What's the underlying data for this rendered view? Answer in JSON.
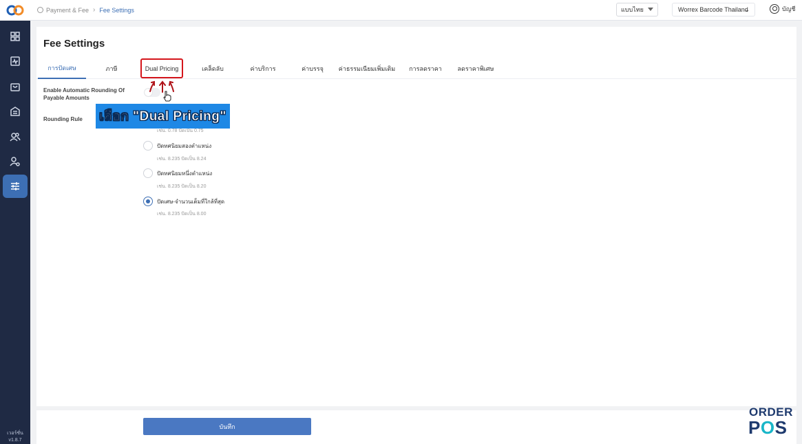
{
  "sidebar": {
    "logo": "order-pos-logo",
    "items": [
      {
        "icon": "dashboard-grid-icon"
      },
      {
        "icon": "activity-chart-icon"
      },
      {
        "icon": "shopping-bag-icon"
      },
      {
        "icon": "inventory-box-icon"
      },
      {
        "icon": "customers-group-icon"
      },
      {
        "icon": "user-settings-icon"
      },
      {
        "icon": "settings-sliders-icon",
        "active": true
      }
    ],
    "version_label": "เวอร์ชั่น",
    "version_number": "v1.8.7"
  },
  "topbar": {
    "breadcrumb_root": "Payment & Fee",
    "breadcrumb_current": "Fee Settings",
    "language": "แบบไทย",
    "store": "Worrex Barcode Thailand",
    "account_label": "บัญชี"
  },
  "page": {
    "title": "Fee Settings",
    "tabs": [
      {
        "label": "การปัดเศษ",
        "active": true
      },
      {
        "label": "ภาษี"
      },
      {
        "label": "Dual Pricing",
        "highlighted": true
      },
      {
        "label": "เคล็ดลับ"
      },
      {
        "label": "ค่าบริการ"
      },
      {
        "label": "ค่าบรรจุ"
      },
      {
        "label": "ค่าธรรมเนียมเพิ่มเติม"
      },
      {
        "label": "การลดราคา"
      },
      {
        "label": "ลดราคาพิเศษ"
      }
    ],
    "auto_rounding_label": "Enable Automatic Rounding Of Payable Amounts",
    "auto_rounding_enabled": false,
    "rounding_rule_label": "Rounding Rule",
    "partial_example": "เช่น. 0.78 ปัดเป็น 0.75",
    "options": [
      {
        "label": "ปัดทศนิยมสองตำแหน่ง",
        "example": "เช่น. 8.235 ปัดเป็น 8.24",
        "checked": false
      },
      {
        "label": "ปัดทศนิยมหนึ่งตำแหน่ง",
        "example": "เช่น. 8.235 ปัดเป็น 8.20",
        "checked": false
      },
      {
        "label": "ปัดเศษ-จำนวนเต็มที่ใกล้ที่สุด",
        "example": "เช่น. 8.235 ปัดเป็น 8.00",
        "checked": true
      }
    ]
  },
  "annotation": {
    "callout": "เลือก \"Dual Pricing\"",
    "highlight_color": "#d4151b",
    "callout_color": "#1e88e5"
  },
  "footer": {
    "save_label": "บันทึก"
  },
  "brand": {
    "line1": "ORDER",
    "line2_a": "P",
    "line2_b": "O",
    "line2_c": "S"
  },
  "colors": {
    "accent": "#3d6fb4",
    "sidebar": "#1f2a44",
    "save_button": "#4a78c2"
  }
}
